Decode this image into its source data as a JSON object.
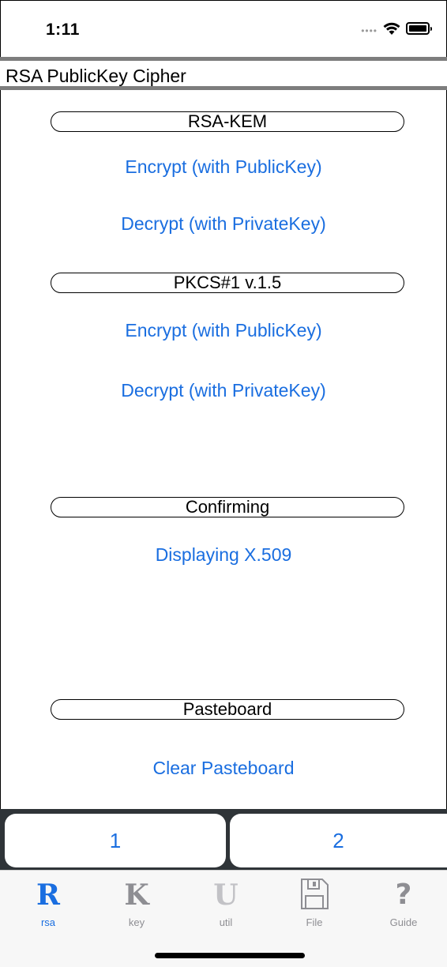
{
  "status_bar": {
    "time": "1:11"
  },
  "header": {
    "title": "RSA PublicKey Cipher"
  },
  "sections": [
    {
      "label": "RSA-KEM",
      "actions": [
        "Encrypt (with PublicKey)",
        "Decrypt (with PrivateKey)"
      ]
    },
    {
      "label": "PKCS#1 v.1.5",
      "actions": [
        "Encrypt (with PublicKey)",
        "Decrypt (with PrivateKey)"
      ]
    },
    {
      "label": "Confirming",
      "actions": [
        "Displaying X.509"
      ]
    },
    {
      "label": "Pasteboard",
      "actions": [
        "Clear Pasteboard"
      ]
    }
  ],
  "segments": [
    "1",
    "2"
  ],
  "tabbar": {
    "tabs": [
      {
        "glyph": "R",
        "label": "rsa",
        "icon": "rsa-icon",
        "selected": true
      },
      {
        "glyph": "K",
        "label": "key",
        "icon": "key-icon",
        "selected": false
      },
      {
        "glyph": "U",
        "label": "util",
        "icon": "util-icon",
        "selected": false
      },
      {
        "glyph": "",
        "label": "File",
        "icon": "floppy-disk-icon",
        "selected": false
      },
      {
        "glyph": "?",
        "label": "Guide",
        "icon": "question-mark-icon",
        "selected": false
      }
    ]
  },
  "colors": {
    "accent": "#1a6ee0",
    "inactive": "#8e8e93",
    "panel": "#2f3438",
    "divider": "#7d7d7d"
  }
}
